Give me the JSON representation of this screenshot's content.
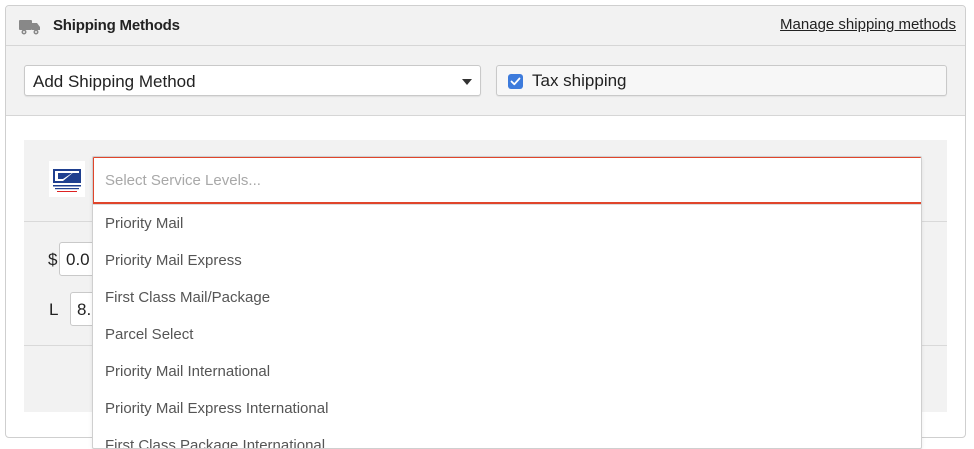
{
  "header": {
    "title": "Shipping Methods",
    "manage_link": "Manage shipping methods",
    "icon": "truck-icon"
  },
  "toolbar": {
    "add_method_select": {
      "value": "Add Shipping Method"
    },
    "tax_shipping": {
      "label": "Tax shipping",
      "checked": true
    }
  },
  "carrier_card": {
    "logo": "usps-logo",
    "price": {
      "currency_symbol": "$",
      "value": "0.0"
    },
    "length": {
      "label": "L",
      "value": "8."
    }
  },
  "service_levels": {
    "placeholder": "Select Service Levels...",
    "options": [
      "Priority Mail",
      "Priority Mail Express",
      "First Class Mail/Package",
      "Parcel Select",
      "Priority Mail International",
      "Priority Mail Express International",
      "First Class Package International"
    ]
  },
  "colors": {
    "focus_border": "#e0452b",
    "checkbox": "#3d7bdc",
    "panel_background": "#f2f2f2"
  }
}
